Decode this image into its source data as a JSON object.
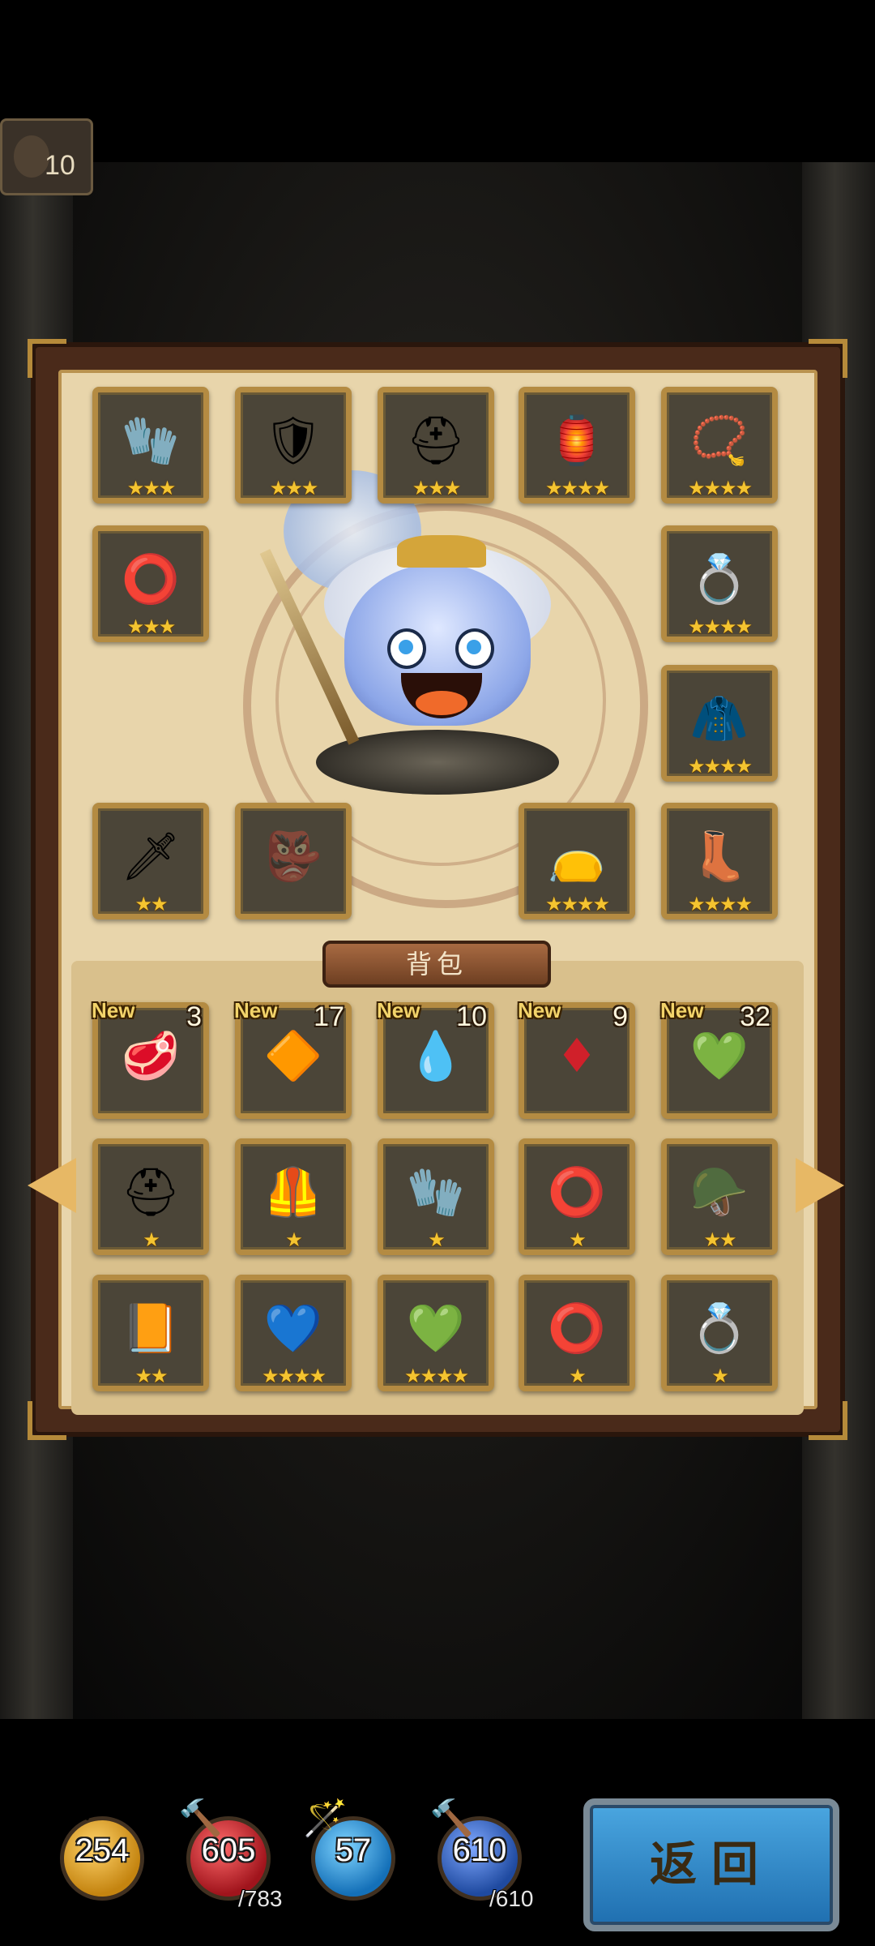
{
  "top_counter": {
    "value": "10",
    "icon": "skull-icon"
  },
  "equipment": {
    "slots": [
      {
        "id": "gauntlet",
        "icon": "🧤",
        "stars": "★★★",
        "color": "#b03a2e"
      },
      {
        "id": "armor",
        "icon": "🛡",
        "stars": "★★★",
        "color": "#b03a2e"
      },
      {
        "id": "helmet",
        "icon": "⛑",
        "stars": "★★★",
        "color": "#b03a2e"
      },
      {
        "id": "lantern",
        "icon": "🏮",
        "stars": "★★★★",
        "color": "#d4a53a"
      },
      {
        "id": "amulet",
        "icon": "📿",
        "stars": "★★★★",
        "color": "#6a3fa8"
      },
      {
        "id": "bracelet",
        "icon": "⭕",
        "stars": "★★★",
        "color": "#8b4a2a"
      },
      {
        "id": "ring",
        "icon": "💍",
        "stars": "★★★★",
        "color": "#6a3fa8"
      },
      {
        "id": "cape",
        "icon": "🧥",
        "stars": "★★★★",
        "color": "#6a3fa8"
      },
      {
        "id": "sword",
        "icon": "🗡",
        "stars": "★★",
        "color": "#8a7a60"
      },
      {
        "id": "empty-mask",
        "icon": "👺",
        "stars": "",
        "color": "#6a6050"
      },
      {
        "id": "pouch",
        "icon": "👝",
        "stars": "★★★★",
        "color": "#c9a03a"
      },
      {
        "id": "boots",
        "icon": "👢",
        "stars": "★★★★",
        "color": "#6a3fa8"
      }
    ]
  },
  "bag": {
    "title": "背包",
    "new_label": "New",
    "items": [
      {
        "icon": "🥩",
        "count": "3",
        "is_new": true,
        "stars": ""
      },
      {
        "icon": "🔶",
        "count": "17",
        "is_new": true,
        "stars": ""
      },
      {
        "icon": "💧",
        "count": "10",
        "is_new": true,
        "stars": ""
      },
      {
        "icon": "♦",
        "count": "9",
        "is_new": true,
        "stars": ""
      },
      {
        "icon": "💚",
        "count": "32",
        "is_new": true,
        "stars": ""
      },
      {
        "icon": "⛑",
        "count": "",
        "is_new": false,
        "stars": "★"
      },
      {
        "icon": "🦺",
        "count": "",
        "is_new": false,
        "stars": "★"
      },
      {
        "icon": "🧤",
        "count": "",
        "is_new": false,
        "stars": "★"
      },
      {
        "icon": "⭕",
        "count": "",
        "is_new": false,
        "stars": "★"
      },
      {
        "icon": "🪖",
        "count": "",
        "is_new": false,
        "stars": "★★"
      },
      {
        "icon": "📙",
        "count": "",
        "is_new": false,
        "stars": "★★"
      },
      {
        "icon": "💙",
        "count": "",
        "is_new": false,
        "stars": "★★★★"
      },
      {
        "icon": "💚",
        "count": "",
        "is_new": false,
        "stars": "★★★★"
      },
      {
        "icon": "⭕",
        "count": "",
        "is_new": false,
        "stars": "★"
      },
      {
        "icon": "💍",
        "count": "",
        "is_new": false,
        "stars": "★"
      }
    ]
  },
  "stats": [
    {
      "id": "attack",
      "value": "254",
      "max": "",
      "orb_color": "#e0a020",
      "tool": "🗡"
    },
    {
      "id": "hp",
      "value": "605",
      "max": "/783",
      "orb_color": "#c0242a",
      "tool": "🔨"
    },
    {
      "id": "magic",
      "value": "57",
      "max": "",
      "orb_color": "#1f8ad0",
      "tool": "🪄"
    },
    {
      "id": "mana",
      "value": "610",
      "max": "/610",
      "orb_color": "#2f5fb8",
      "tool": "🔨"
    }
  ],
  "back_button": {
    "label": "返回"
  }
}
